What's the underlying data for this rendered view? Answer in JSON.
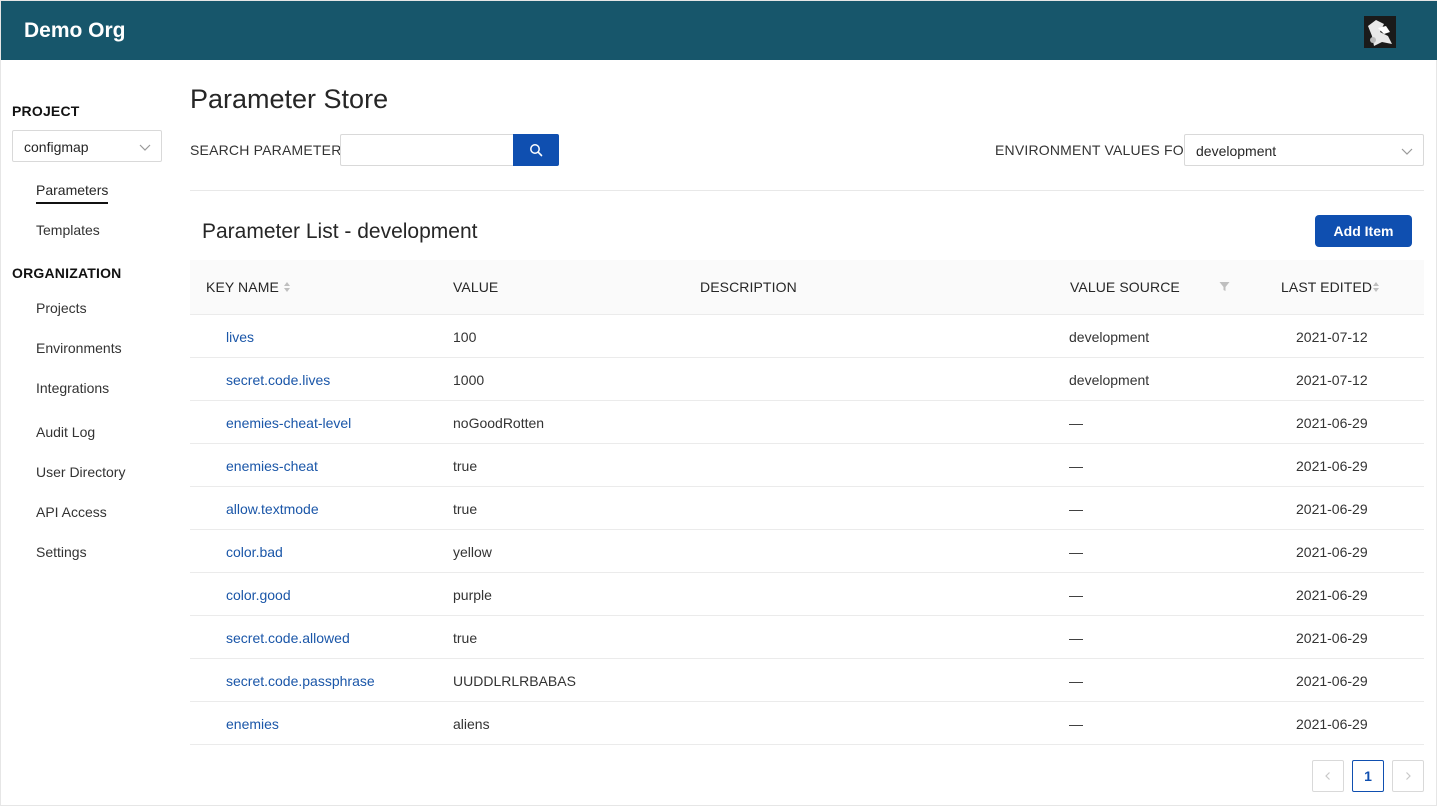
{
  "header": {
    "org_name": "Demo Org",
    "avatar_icon": "user-avatar"
  },
  "sidebar": {
    "project_heading": "PROJECT",
    "project_select_value": "configmap",
    "project_items": [
      {
        "label": "Parameters",
        "active": true
      },
      {
        "label": "Templates",
        "active": false
      }
    ],
    "organization_heading": "ORGANIZATION",
    "organization_items": [
      {
        "label": "Projects"
      },
      {
        "label": "Environments"
      },
      {
        "label": "Integrations"
      },
      {
        "label": "Audit Log"
      },
      {
        "label": "User Directory"
      },
      {
        "label": "API Access"
      },
      {
        "label": "Settings"
      }
    ]
  },
  "main": {
    "title": "Parameter Store",
    "search_label": "SEARCH PARAMETERS:",
    "search_value": "",
    "search_icon": "search-icon",
    "env_label": "ENVIRONMENT VALUES FOR:",
    "env_select_value": "development",
    "list_title": "Parameter List - development",
    "add_button_label": "Add Item"
  },
  "table": {
    "columns": {
      "key_name": "KEY NAME",
      "value": "VALUE",
      "description": "DESCRIPTION",
      "value_source": "VALUE SOURCE",
      "last_edited": "LAST EDITED"
    },
    "rows": [
      {
        "key": "lives",
        "value": "100",
        "description": "",
        "source": "development",
        "edited": "2021-07-12"
      },
      {
        "key": "secret.code.lives",
        "value": "1000",
        "description": "",
        "source": "development",
        "edited": "2021-07-12"
      },
      {
        "key": "enemies-cheat-level",
        "value": "noGoodRotten",
        "description": "",
        "source": "—",
        "edited": "2021-06-29"
      },
      {
        "key": "enemies-cheat",
        "value": "true",
        "description": "",
        "source": "—",
        "edited": "2021-06-29"
      },
      {
        "key": "allow.textmode",
        "value": "true",
        "description": "",
        "source": "—",
        "edited": "2021-06-29"
      },
      {
        "key": "color.bad",
        "value": "yellow",
        "description": "",
        "source": "—",
        "edited": "2021-06-29"
      },
      {
        "key": "color.good",
        "value": "purple",
        "description": "",
        "source": "—",
        "edited": "2021-06-29"
      },
      {
        "key": "secret.code.allowed",
        "value": "true",
        "description": "",
        "source": "—",
        "edited": "2021-06-29"
      },
      {
        "key": "secret.code.passphrase",
        "value": "UUDDLRLRBABAS",
        "description": "",
        "source": "—",
        "edited": "2021-06-29"
      },
      {
        "key": "enemies",
        "value": "aliens",
        "description": "",
        "source": "—",
        "edited": "2021-06-29"
      }
    ]
  },
  "pagination": {
    "current_page": "1",
    "prev_icon": "chevron-left-icon",
    "next_icon": "chevron-right-icon"
  },
  "colors": {
    "header_bg": "#17566b",
    "primary": "#0f4fb0",
    "link": "#1a56a8"
  }
}
